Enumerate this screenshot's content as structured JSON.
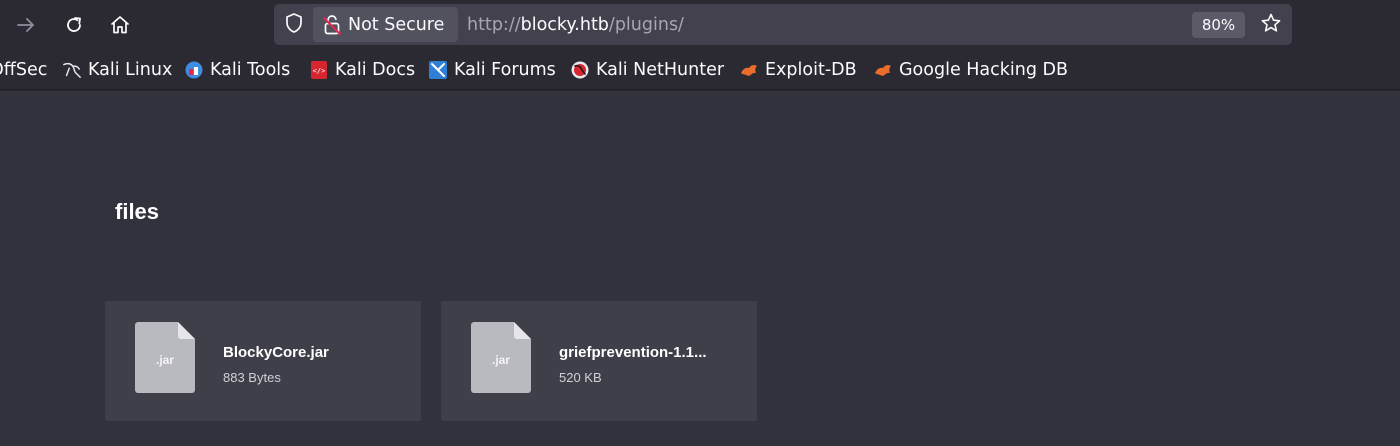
{
  "toolbar": {
    "forward_icon": "arrow-right-icon",
    "reload_icon": "reload-icon",
    "home_icon": "home-icon"
  },
  "urlbar": {
    "security_label": "Not Secure",
    "url_scheme": "http://",
    "url_host": "blocky.htb",
    "url_path": "/plugins/",
    "zoom": "80%"
  },
  "bookmarks": [
    {
      "label": "OffSec",
      "icon": "offsec-icon"
    },
    {
      "label": "Kali Linux",
      "icon": "kali-dragon-icon"
    },
    {
      "label": "Kali Tools",
      "icon": "kali-tools-icon"
    },
    {
      "label": "Kali Docs",
      "icon": "kali-docs-icon"
    },
    {
      "label": "Kali Forums",
      "icon": "kali-forums-icon"
    },
    {
      "label": "Kali NetHunter",
      "icon": "kali-nethunter-icon"
    },
    {
      "label": "Exploit-DB",
      "icon": "exploit-db-icon"
    },
    {
      "label": "Google Hacking DB",
      "icon": "exploit-db-icon"
    }
  ],
  "page": {
    "heading": "files",
    "files": [
      {
        "ext": ".jar",
        "name": "BlockyCore.jar",
        "size": "883 Bytes"
      },
      {
        "ext": ".jar",
        "name": "griefprevention-1.1...",
        "size": "520 KB"
      }
    ]
  },
  "colors": {
    "chrome_bg": "#2b2a33",
    "urlbar_bg": "#42414d",
    "content_bg": "#32323c",
    "card_bg": "#3f3f4a",
    "file_icon": "#b9b9c0",
    "insecure_red": "#e22850",
    "exploit_orange": "#ea6d2b"
  }
}
